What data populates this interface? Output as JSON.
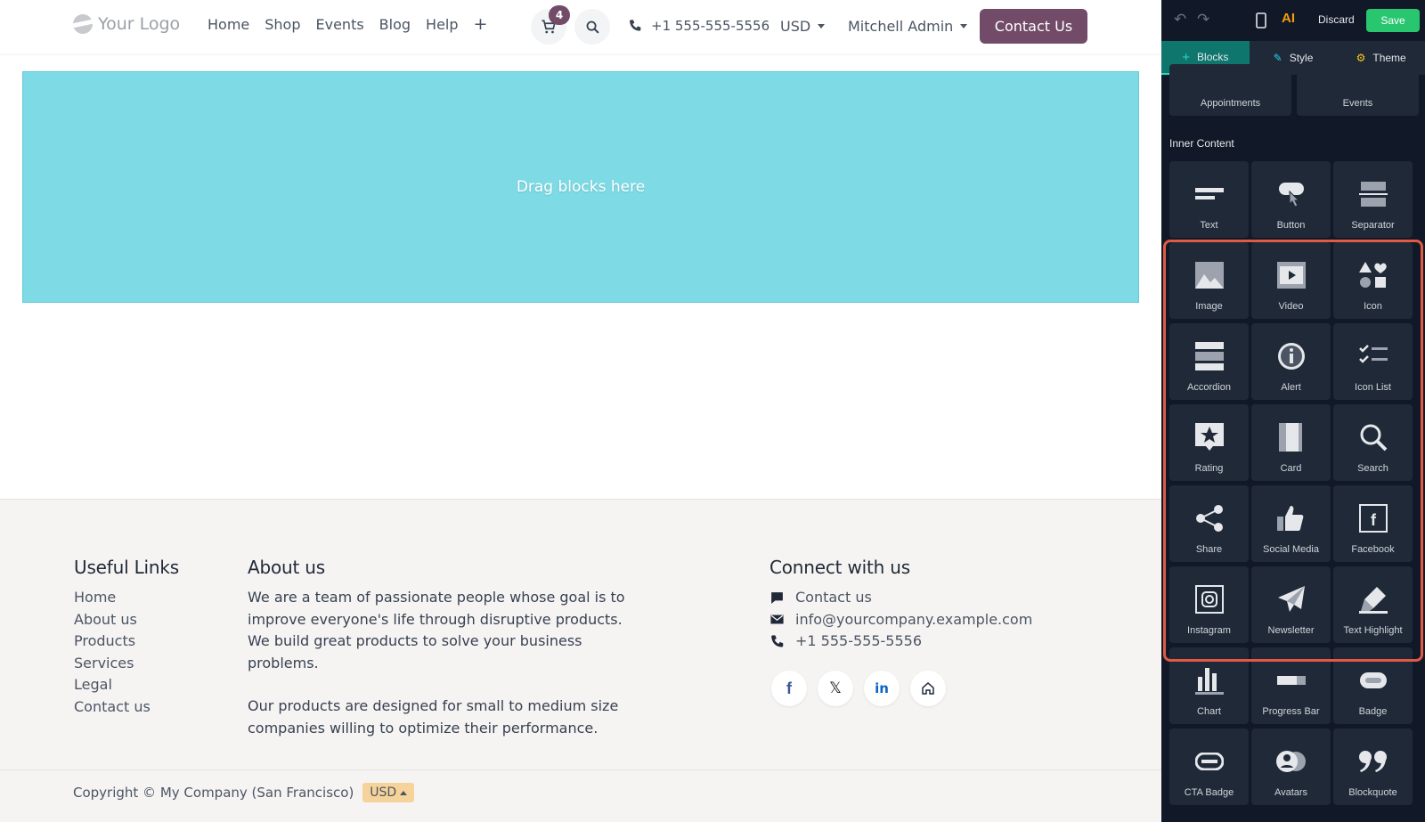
{
  "header": {
    "logo_text": "Your Logo",
    "nav": [
      "Home",
      "Shop",
      "Events",
      "Blog",
      "Help"
    ],
    "nav_plus": "+",
    "cart_count": "4",
    "phone": "+1 555-555-5556",
    "currency": "USD",
    "user": "Mitchell Admin",
    "contact_button": "Contact Us"
  },
  "dropzone": {
    "text": "Drag blocks here"
  },
  "footer": {
    "links_title": "Useful Links",
    "links": [
      "Home",
      "About us",
      "Products",
      "Services",
      "Legal",
      "Contact us"
    ],
    "about_title": "About us",
    "about_p1": "We are a team of passionate people whose goal is to improve everyone's life through disruptive products. We build great products to solve your business problems.",
    "about_p2": "Our products are designed for small to medium size companies willing to optimize their performance.",
    "connect_title": "Connect with us",
    "connect_contact": "Contact us",
    "connect_email": "info@yourcompany.example.com",
    "connect_phone": "+1 555-555-5556",
    "socials": [
      "facebook-icon",
      "x-icon",
      "linkedin-icon",
      "home-icon"
    ],
    "copyright": "Copyright © My Company (San Francisco)",
    "currency_chip": "USD"
  },
  "panel": {
    "discard": "Discard",
    "save": "Save",
    "tabs": [
      "Blocks",
      "Style",
      "Theme"
    ],
    "top_tiles": [
      "Appointments",
      "Events"
    ],
    "section": "Inner Content",
    "tiles": [
      {
        "label": "Text",
        "icon": "text-icon"
      },
      {
        "label": "Button",
        "icon": "button-icon"
      },
      {
        "label": "Separator",
        "icon": "separator-icon"
      },
      {
        "label": "Image",
        "icon": "image-icon"
      },
      {
        "label": "Video",
        "icon": "video-icon"
      },
      {
        "label": "Icon",
        "icon": "shapes-icon"
      },
      {
        "label": "Accordion",
        "icon": "accordion-icon"
      },
      {
        "label": "Alert",
        "icon": "alert-icon"
      },
      {
        "label": "Icon List",
        "icon": "icon-list-icon"
      },
      {
        "label": "Rating",
        "icon": "rating-icon"
      },
      {
        "label": "Card",
        "icon": "card-icon"
      },
      {
        "label": "Search",
        "icon": "search-icon"
      },
      {
        "label": "Share",
        "icon": "share-icon"
      },
      {
        "label": "Social Media",
        "icon": "thumbs-up-icon"
      },
      {
        "label": "Facebook",
        "icon": "facebook-icon"
      },
      {
        "label": "Instagram",
        "icon": "instagram-icon"
      },
      {
        "label": "Newsletter",
        "icon": "paper-plane-icon"
      },
      {
        "label": "Text Highlight",
        "icon": "highlighter-icon"
      },
      {
        "label": "Chart",
        "icon": "chart-icon"
      },
      {
        "label": "Progress Bar",
        "icon": "progress-bar-icon"
      },
      {
        "label": "Badge",
        "icon": "badge-icon"
      },
      {
        "label": "CTA Badge",
        "icon": "cta-badge-icon"
      },
      {
        "label": "Avatars",
        "icon": "avatars-icon"
      },
      {
        "label": "Blockquote",
        "icon": "quote-icon"
      }
    ]
  },
  "colors": {
    "brand": "#714b67",
    "dropzone": "#7edbe6",
    "save": "#28c76f",
    "highlight": "#e05a45"
  }
}
